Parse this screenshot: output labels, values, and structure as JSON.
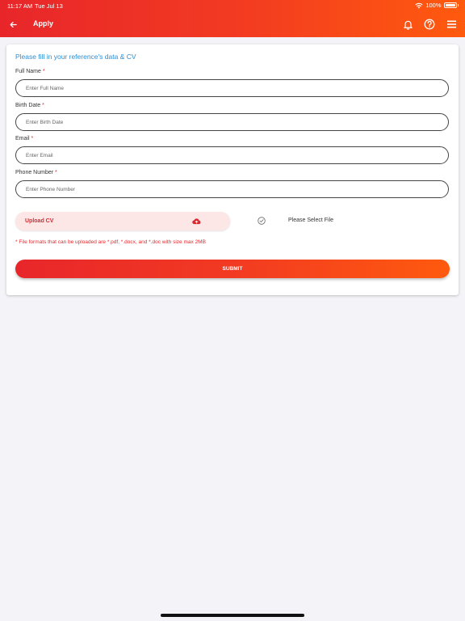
{
  "status_bar": {
    "time": "11:17 AM",
    "date": "Tue Jul 13",
    "battery": "100%"
  },
  "header": {
    "title": "Apply",
    "background_colors": [
      "#e8262a",
      "#ff5a0e"
    ]
  },
  "icons": {
    "back": "arrow-left-icon",
    "notifications": "bell-icon",
    "help": "question-circle-icon",
    "menu": "hamburger-menu-icon",
    "upload": "cloud-upload-icon",
    "file_status": "check-circle-icon"
  },
  "form": {
    "heading": "Please fill in your reference's data & CV",
    "required_mark": "*",
    "fields": [
      {
        "label": "Full Name",
        "placeholder": "Enter Full Name"
      },
      {
        "label": "Birth Date",
        "placeholder": "Enter Birth Date"
      },
      {
        "label": "Email",
        "placeholder": "Enter Email"
      },
      {
        "label": "Phone Number",
        "placeholder": "Enter Phone Number"
      }
    ],
    "upload_label": "Upload CV",
    "file_status_text": "Please Select File",
    "file_note": "* File formats that can be uploaded are *.pdf, *.docx, and *.doc with size max 2MB",
    "submit_label": "SUBMIT"
  },
  "colors": {
    "accent": "#e8262a",
    "link_heading": "#2d8ed6",
    "upload_bg": "#fde6e6"
  }
}
